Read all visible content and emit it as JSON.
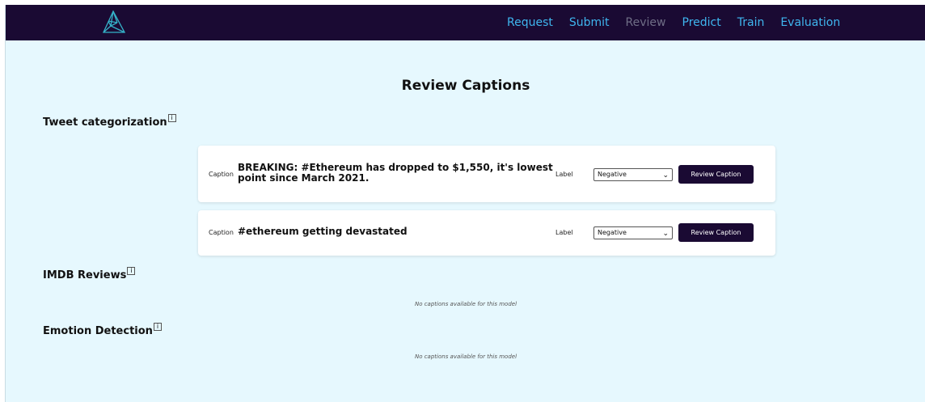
{
  "nav": {
    "items": [
      {
        "label": "Request"
      },
      {
        "label": "Submit"
      },
      {
        "label": "Review",
        "active": true
      },
      {
        "label": "Predict"
      },
      {
        "label": "Train"
      },
      {
        "label": "Evaluation"
      }
    ],
    "logo_icon": "triangle-network-logo"
  },
  "colors": {
    "navbar": "#1a0a33",
    "nav_link": "#3fb6ef",
    "nav_active": "#6f6e86",
    "page_bg": "#e6f8fe",
    "button": "#1a0a33"
  },
  "page": {
    "title": "Review Captions"
  },
  "sections": [
    {
      "heading": "Tweet categorization",
      "info_icon": "info-icon",
      "captions": [
        {
          "caption_label": "Caption",
          "text": "BREAKING: #Ethereum has dropped to $1,550, it's lowest point since March 2021.",
          "label_label": "Label",
          "selected_label": "Negative",
          "button_label": "Review Caption"
        },
        {
          "caption_label": "Caption",
          "text": "#ethereum getting devastated",
          "label_label": "Label",
          "selected_label": "Negative",
          "button_label": "Review Caption"
        }
      ]
    },
    {
      "heading": "IMDB Reviews",
      "info_icon": "info-icon",
      "empty_text": "No captions available for this model"
    },
    {
      "heading": "Emotion Detection",
      "info_icon": "info-icon",
      "empty_text": "No captions available for this model"
    }
  ]
}
